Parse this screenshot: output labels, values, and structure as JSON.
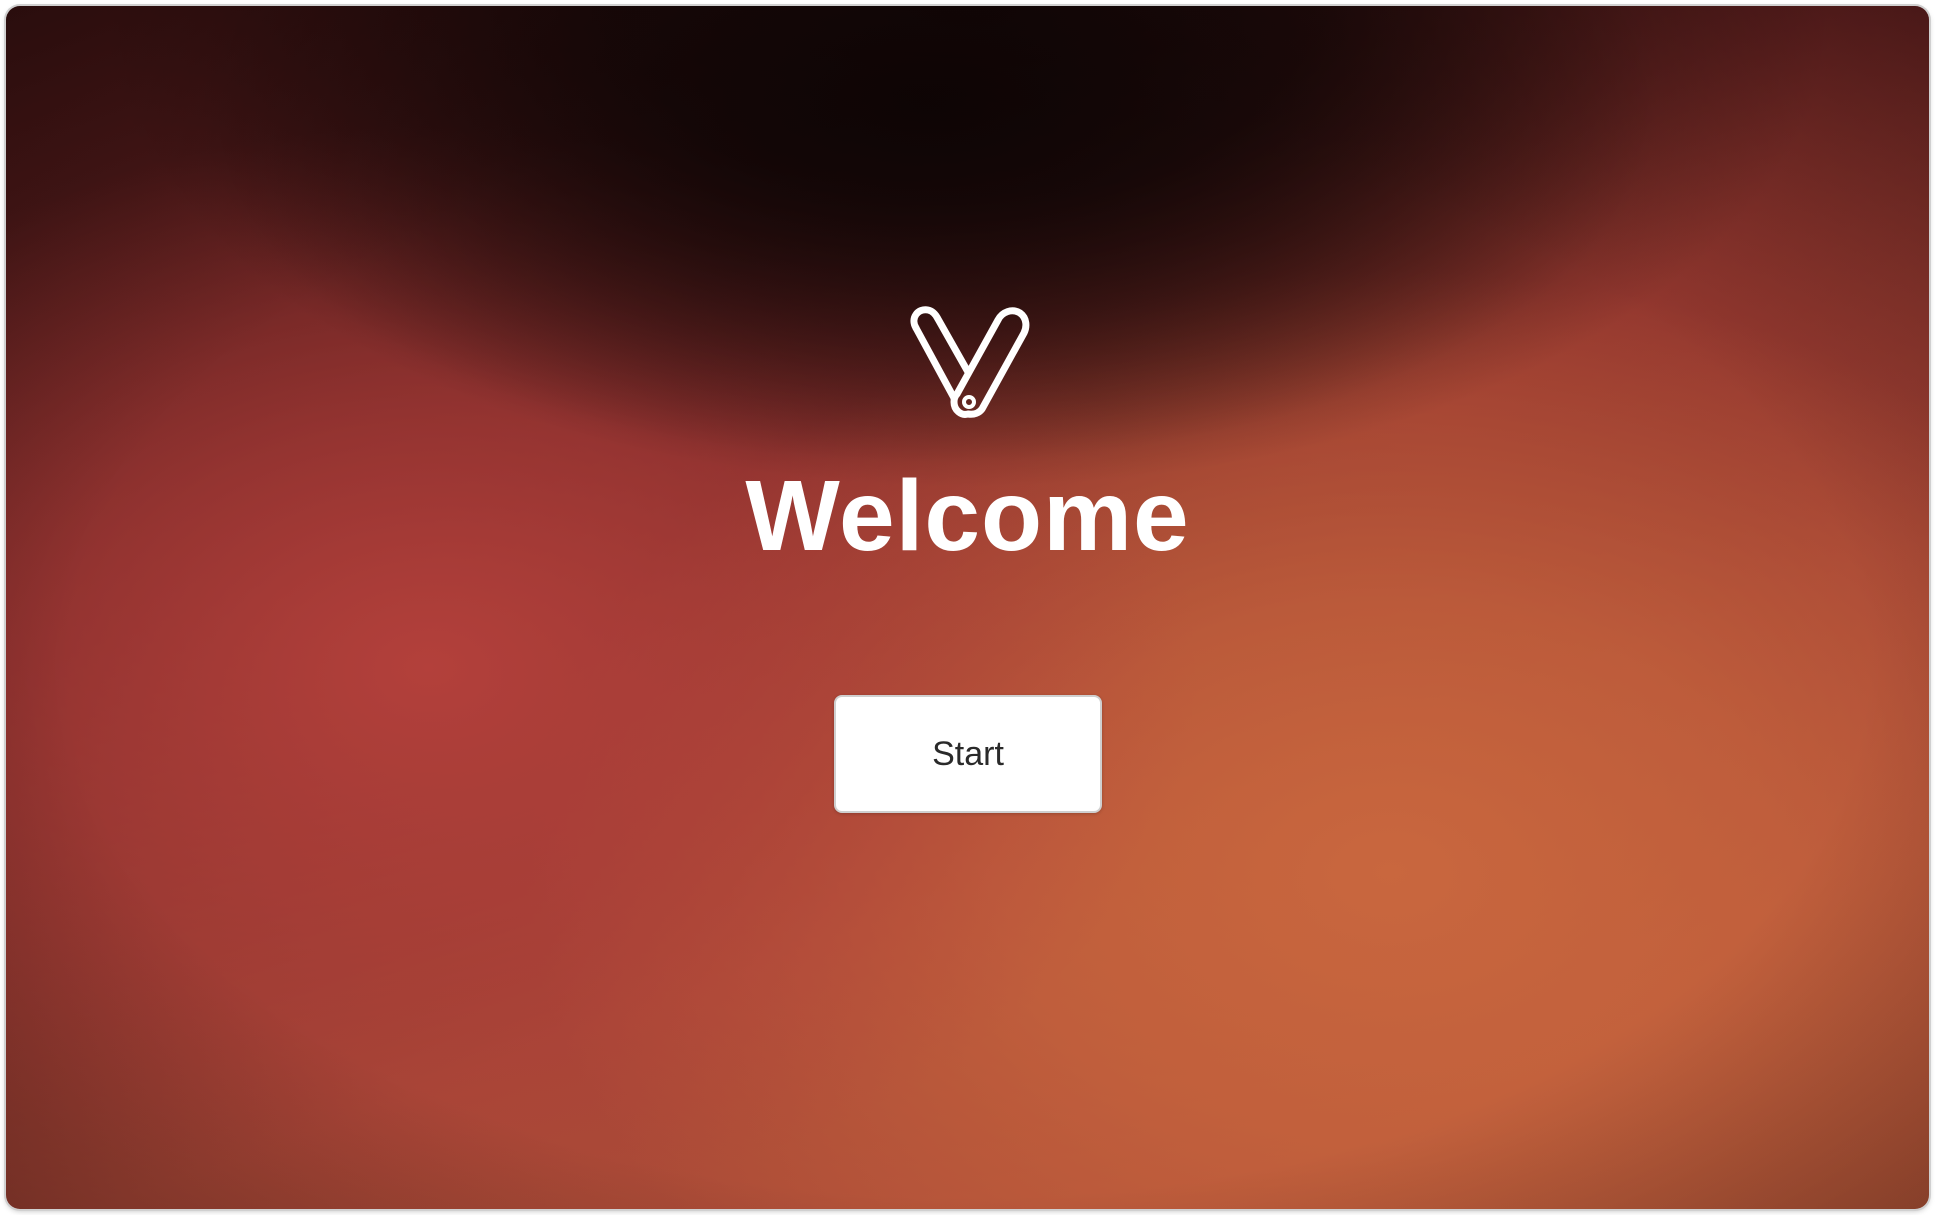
{
  "welcome": {
    "logo_icon": "v-logo-icon",
    "title": "Welcome",
    "start_label": "Start"
  },
  "colors": {
    "background_dark": "#170808",
    "background_red": "#b3403b",
    "background_orange": "#c9673e",
    "button_background": "#ffffff",
    "button_text": "#2a2a2a",
    "title_text": "#ffffff"
  }
}
